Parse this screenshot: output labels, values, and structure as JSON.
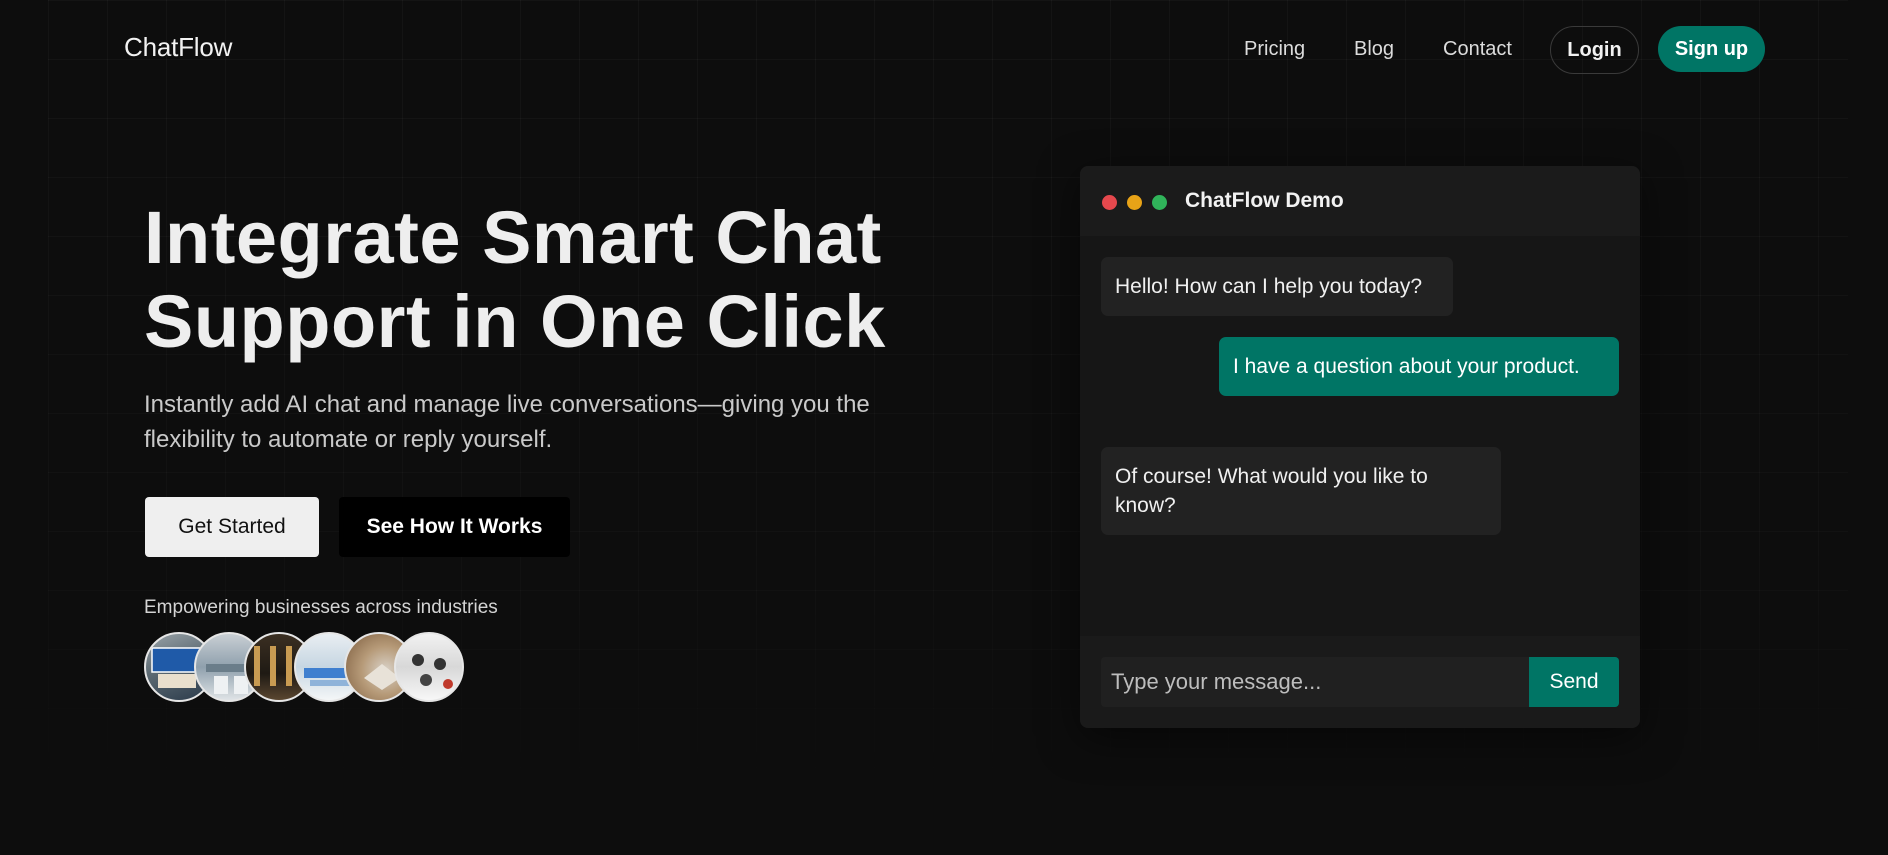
{
  "brand": {
    "name": "ChatFlow"
  },
  "nav": {
    "links": [
      "Pricing",
      "Blog",
      "Contact"
    ],
    "login_label": "Login",
    "signup_label": "Sign up"
  },
  "hero": {
    "title_line1": "Integrate Smart Chat",
    "title_line2": "Support in One Click",
    "subtitle": "Instantly add AI chat and manage live conversations—giving you the flexibility to automate or reply yourself.",
    "primary_cta": "Get Started",
    "secondary_cta": "See How It Works",
    "industries_label": "Empowering businesses across industries",
    "industry_avatars": [
      "open-shop-sign",
      "office-interior",
      "restaurant-interior",
      "classroom",
      "pharmacy-counter",
      "store-shelves"
    ]
  },
  "demo": {
    "title": "ChatFlow Demo",
    "window_dots": [
      "#e5484d",
      "#e8a317",
      "#30b45a"
    ],
    "messages": [
      {
        "from": "bot",
        "text": "Hello! How can I help you today?"
      },
      {
        "from": "user",
        "text": "I have a question about your product."
      },
      {
        "from": "bot",
        "text": "Of course! What would you like to know?"
      }
    ],
    "input_placeholder": "Type your message...",
    "send_label": "Send"
  },
  "colors": {
    "background": "#0d0d0d",
    "accent": "#007565",
    "panel": "#161616",
    "bubble_bot": "#222222"
  }
}
